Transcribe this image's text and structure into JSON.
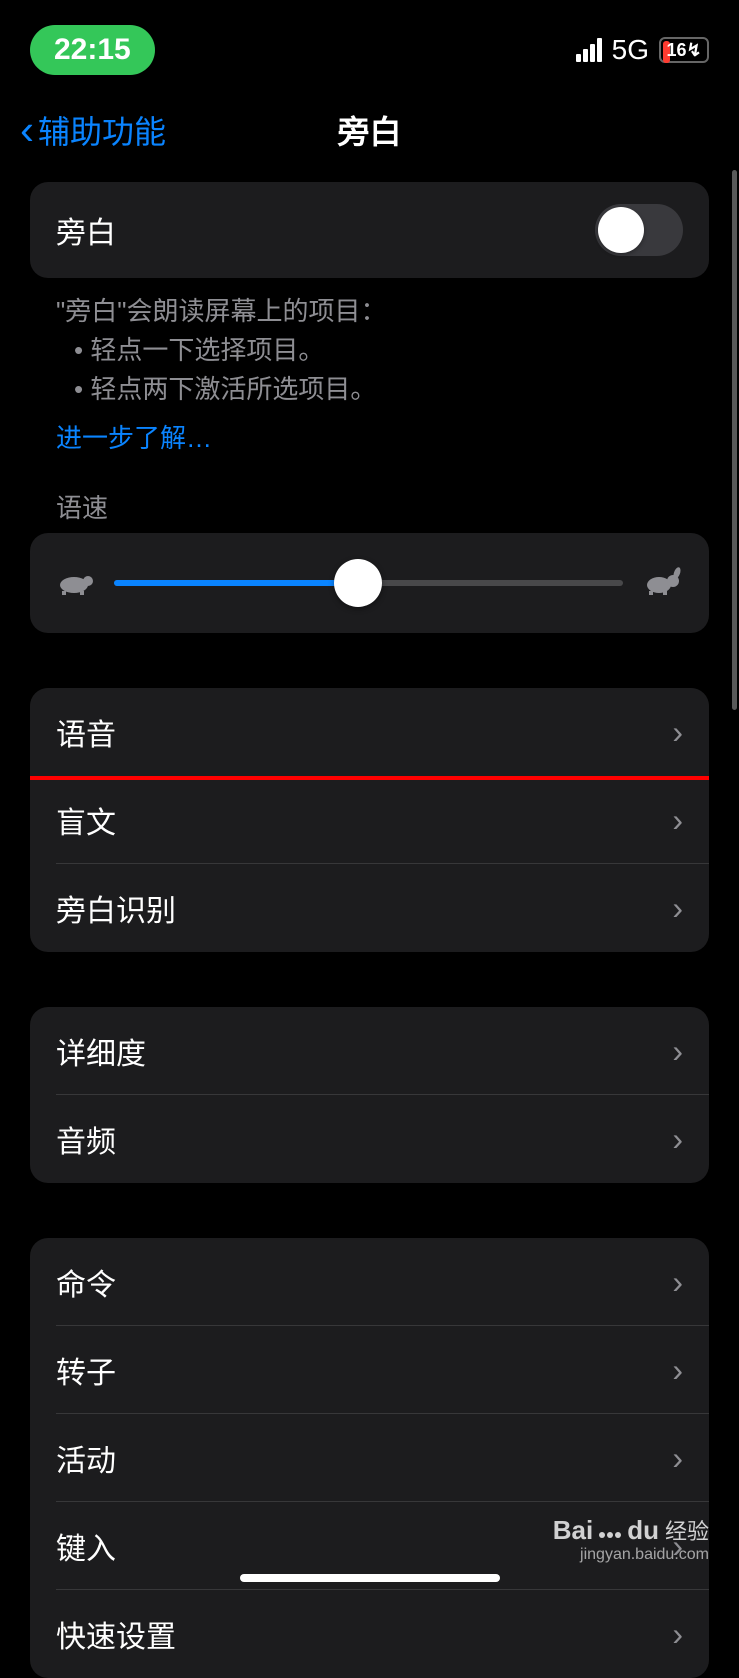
{
  "status_bar": {
    "time": "22:15",
    "network": "5G",
    "battery": "16"
  },
  "nav": {
    "back_label": "辅助功能",
    "title": "旁白"
  },
  "voiceover": {
    "toggle_label": "旁白",
    "description_intro": "\"旁白\"会朗读屏幕上的项目：",
    "bullet1": "• 轻点一下选择项目。",
    "bullet2": "• 轻点两下激活所选项目。",
    "learn_more": "进一步了解…"
  },
  "speed": {
    "header": "语速",
    "slow_icon": "turtle",
    "fast_icon": "rabbit",
    "value_percent": 48
  },
  "group1": {
    "items": [
      "语音",
      "盲文",
      "旁白识别"
    ]
  },
  "group2": {
    "items": [
      "详细度",
      "音频"
    ]
  },
  "group3": {
    "items": [
      "命令",
      "转子",
      "活动",
      "键入",
      "快速设置"
    ]
  },
  "watermark": {
    "main": "Baidu 经验",
    "sub": "jingyan.baidu.com"
  }
}
